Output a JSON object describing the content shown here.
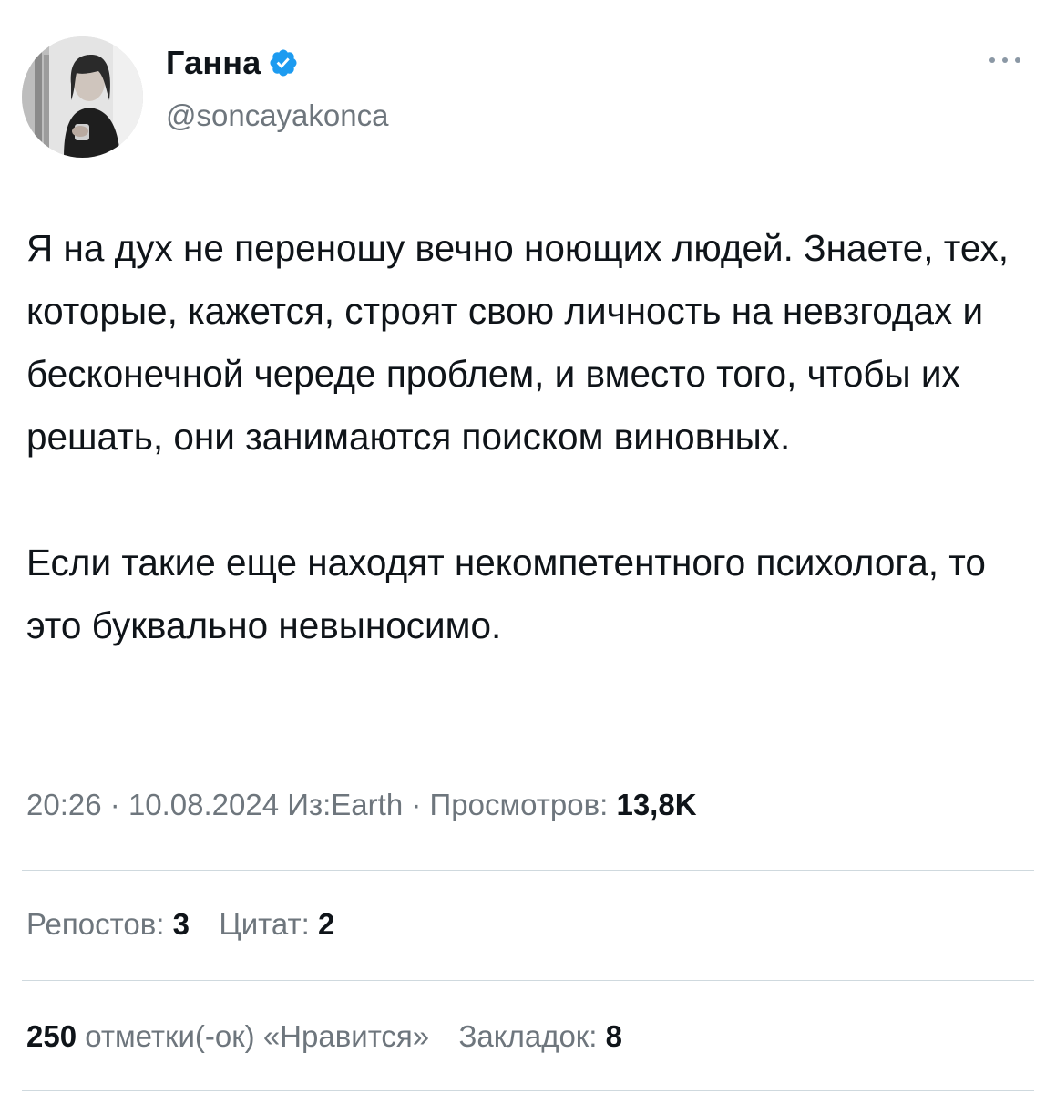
{
  "author": {
    "display_name": "Ганна",
    "handle": "@soncayakonca",
    "verified": true
  },
  "tweet": {
    "paragraphs": [
      "Я на дух не переношу вечно ноющих людей. Знаете, тех, которые, кажется, строят свою личность на невзгодах и бесконечной череде проблем, и вместо того, чтобы их решать, они занимаются поиском виновных.",
      "Если такие еще находят некомпетентного психолога, то это буквально невыносимо."
    ]
  },
  "meta": {
    "time": "20:26",
    "date": "10.08.2024",
    "source": "Из:Earth",
    "views_label": "Просмотров:",
    "views_value": "13,8K"
  },
  "stats": {
    "reposts_label": "Репостов:",
    "reposts_value": "3",
    "quotes_label": "Цитат:",
    "quotes_value": "2",
    "likes_value": "250",
    "likes_label": "отметки(-ок) «Нравится»",
    "bookmarks_label": "Закладок:",
    "bookmarks_value": "8"
  },
  "icons": {
    "verified": "verified-badge-icon",
    "more": "more-options-icon"
  },
  "colors": {
    "verified_blue": "#1d9bf0",
    "secondary_text": "#6e767d",
    "primary_text": "#0f1419",
    "divider": "#cfd9de"
  }
}
